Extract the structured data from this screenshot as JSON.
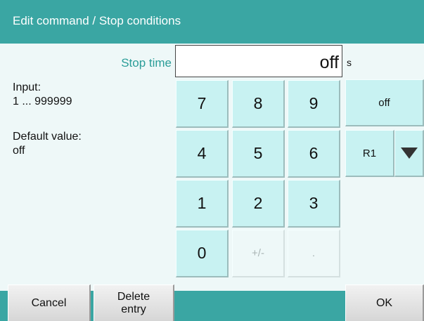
{
  "window": {
    "title": "Edit command / Stop conditions"
  },
  "field": {
    "label": "Stop time",
    "value": "off",
    "unit": "s"
  },
  "info": {
    "input_label": "Input:",
    "input_range": "1 ... 999999",
    "default_label": "Default value:",
    "default_value": "off"
  },
  "keypad": {
    "k7": "7",
    "k8": "8",
    "k9": "9",
    "k4": "4",
    "k5": "5",
    "k6": "6",
    "k1": "1",
    "k2": "2",
    "k3": "3",
    "k0": "0",
    "sign": "+/-",
    "dot": "."
  },
  "side": {
    "off_label": "off",
    "register_label": "R1"
  },
  "buttons": {
    "cancel": "Cancel",
    "delete_line1": "Delete",
    "delete_line2": "entry",
    "ok": "OK"
  },
  "colors": {
    "accent": "#3aa6a3",
    "key": "#c8f2f2",
    "background": "#eef8f8",
    "label": "#2a9d98"
  }
}
